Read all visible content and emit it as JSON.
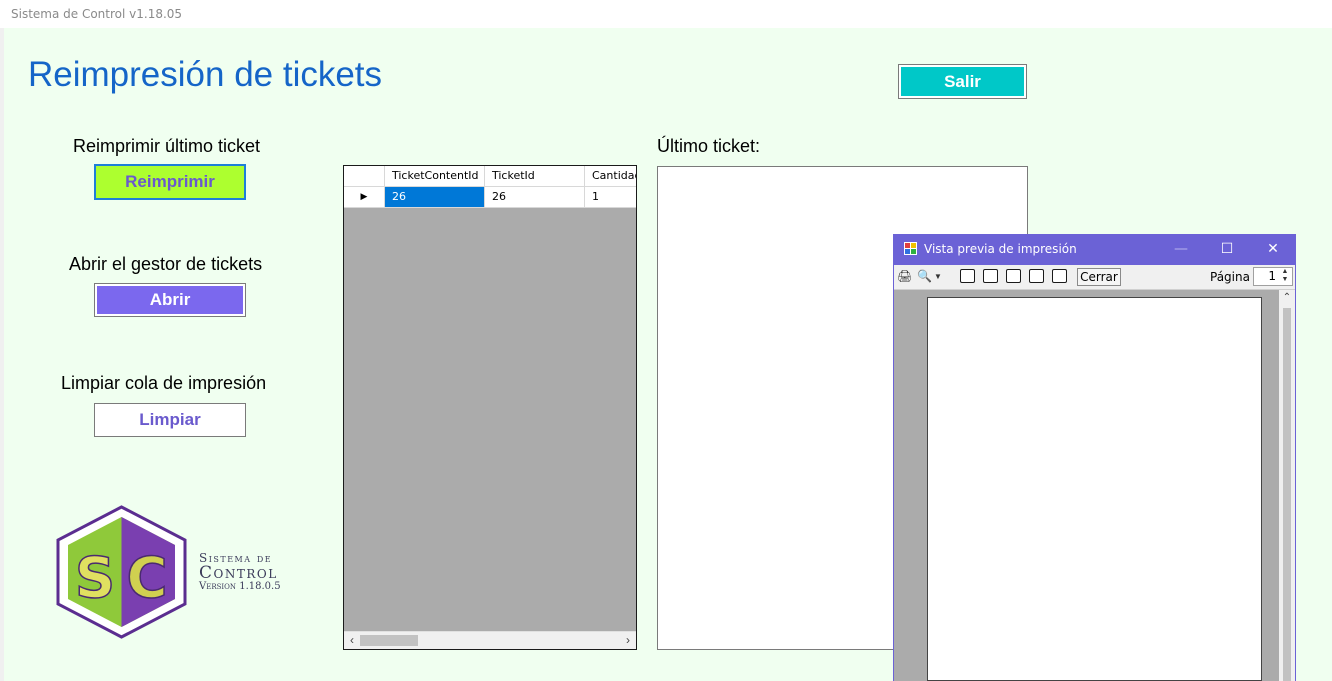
{
  "window": {
    "title": "Sistema de Control v1.18.05"
  },
  "page": {
    "title": "Reimpresión de tickets"
  },
  "buttons": {
    "salir": "Salir",
    "reimprimir": "Reimprimir",
    "abrir": "Abrir",
    "limpiar": "Limpiar"
  },
  "sections": {
    "reimprimir_label": "Reimprimir último ticket",
    "abrir_label": "Abrir el gestor de tickets",
    "limpiar_label": "Limpiar cola de impresión",
    "ultimo_ticket_label": "Último ticket:"
  },
  "grid": {
    "columns": [
      "TicketContentId",
      "TicketId",
      "Cantidad"
    ],
    "rows": [
      [
        "26",
        "26",
        "1"
      ]
    ]
  },
  "logo": {
    "initials": "SC",
    "line1": "Sistema de",
    "line2": "Control",
    "line3": "Version 1.18.0.5"
  },
  "print_preview": {
    "title": "Vista previa de impresión",
    "close_label": "Cerrar",
    "page_label": "Página",
    "page_value": "1"
  },
  "colors": {
    "title_blue": "#1565c8",
    "salir_bg": "#00c8c8",
    "reimprimir_bg": "#adff2f",
    "abrir_bg": "#7b68ee",
    "form_bg": "#f0fff0",
    "preview_titlebar": "#6b62d6",
    "selection": "#0078d7"
  }
}
